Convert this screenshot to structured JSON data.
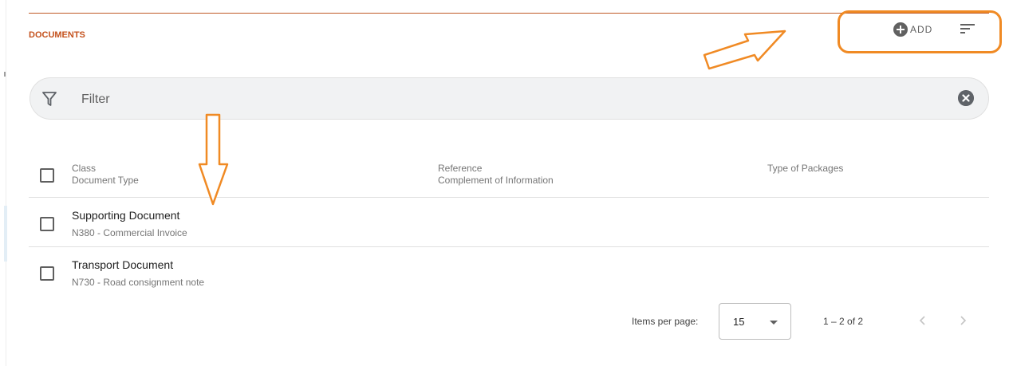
{
  "section": {
    "title": "DOCUMENTS"
  },
  "toolbar": {
    "add_label": "ADD",
    "add_icon": "plus-circle-icon",
    "sort_icon": "sort-icon"
  },
  "filter": {
    "placeholder": "Filter",
    "value": "",
    "filter_icon": "funnel-icon",
    "clear_icon": "clear-circle-icon"
  },
  "table": {
    "columns": [
      {
        "primary": "Class",
        "secondary": "Document Type"
      },
      {
        "primary": "Reference",
        "secondary": "Complement of Information"
      },
      {
        "primary": "Type of Packages",
        "secondary": ""
      }
    ],
    "rows": [
      {
        "title": "Supporting Document",
        "subtitle": "N380 - Commercial Invoice",
        "checked": false
      },
      {
        "title": "Transport Document",
        "subtitle": "N730 - Road consignment note",
        "checked": false
      }
    ]
  },
  "paginator": {
    "items_per_page_label": "Items per page:",
    "page_size": "15",
    "range_label": "1 – 2 of 2"
  },
  "colors": {
    "accent": "#c4511c",
    "annotation": "#f08a24"
  }
}
